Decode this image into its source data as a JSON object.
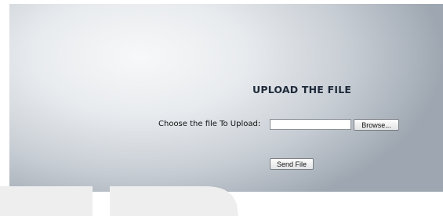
{
  "upload_form": {
    "title": "UPLOAD THE FILE",
    "file_label": "Choose the file To Upload:",
    "file_value": "",
    "browse_label": "Browse...",
    "send_label": "Send File"
  },
  "colors": {
    "title": "#1e2a3a",
    "background_light": "#f7f8f9",
    "background_dark": "#9ea7b1",
    "watermark": "#eeeeee"
  }
}
